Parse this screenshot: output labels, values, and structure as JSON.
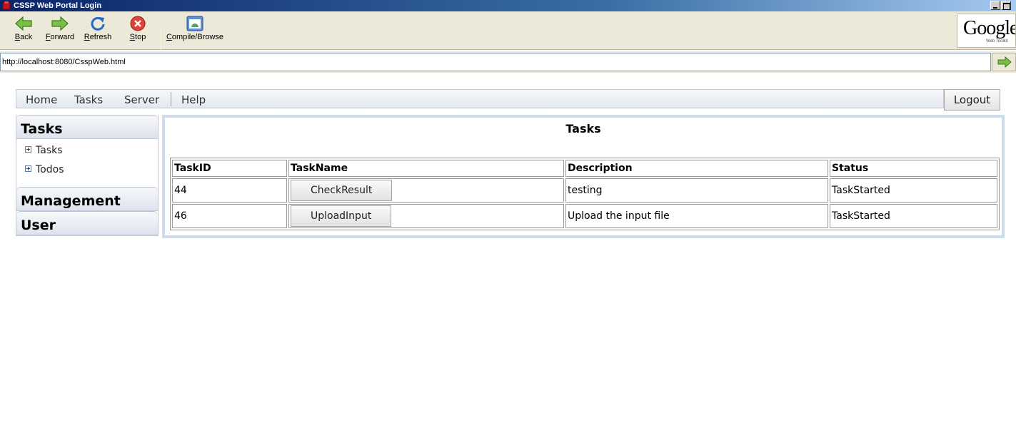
{
  "window": {
    "title": "CSSP Web Portal Login",
    "title_icon": "app-icon"
  },
  "toolbar": {
    "back_label": "Back",
    "forward_label": "Forward",
    "refresh_label": "Refresh",
    "stop_label": "Stop",
    "compile_label": "Compile/Browse"
  },
  "branding": {
    "logo_text": "Google",
    "logo_subtext": "Web Toolkit"
  },
  "address": {
    "url": "http://localhost:8080/CsspWeb.html"
  },
  "menu": {
    "home": "Home",
    "tasks": "Tasks",
    "server": "Server",
    "help": "Help",
    "logout": "Logout"
  },
  "sidebar": {
    "sections": [
      {
        "label": "Tasks",
        "items": [
          {
            "label": "Tasks"
          },
          {
            "label": "Todos"
          }
        ]
      },
      {
        "label": "Management"
      },
      {
        "label": "User"
      }
    ]
  },
  "main": {
    "title": "Tasks",
    "columns": [
      "TaskID",
      "TaskName",
      "Description",
      "Status"
    ],
    "rows": [
      {
        "id": "44",
        "name": "CheckResult",
        "description": "testing",
        "status": "TaskStarted"
      },
      {
        "id": "46",
        "name": "UploadInput",
        "description": "Upload the input file",
        "status": "TaskStarted"
      }
    ]
  },
  "colors": {
    "titlebar_start": "#0a246a",
    "panel_border": "#cfdcec",
    "toolbar_bg": "#ece9d8"
  }
}
